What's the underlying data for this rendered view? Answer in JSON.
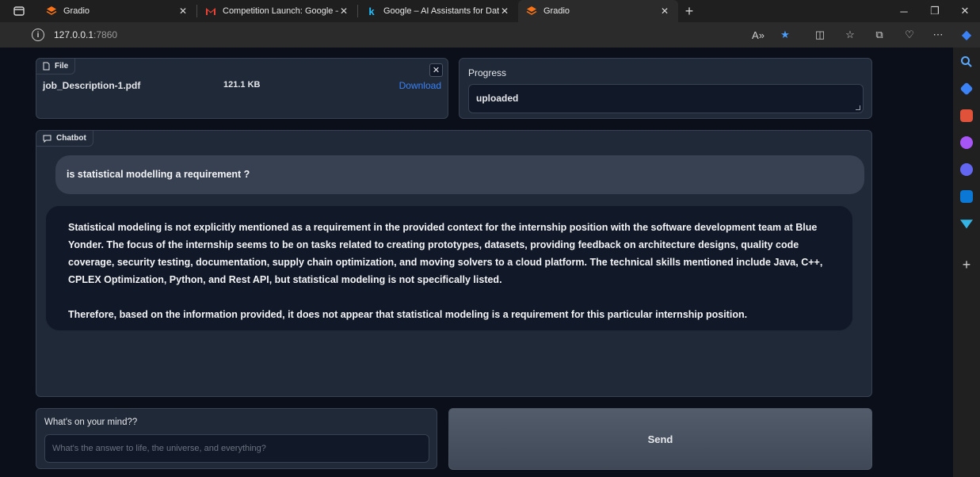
{
  "browser": {
    "tabs": [
      {
        "title": "Gradio",
        "active": false
      },
      {
        "title": "Competition Launch: Google – AI",
        "active": false
      },
      {
        "title": "Google – AI Assistants for Data T",
        "active": false
      },
      {
        "title": "Gradio",
        "active": true
      }
    ],
    "address": {
      "host": "127.0.0.1",
      "port": ":7860"
    }
  },
  "file_block": {
    "label": "File",
    "file_name": "job_Description-1.pdf",
    "file_size": "121.1 KB",
    "download_label": "Download"
  },
  "progress": {
    "label": "Progress",
    "value": "uploaded"
  },
  "chatbot": {
    "label": "Chatbot",
    "user_message": "is statistical modelling a requirement ?",
    "bot_paragraphs": [
      "Statistical modeling is not explicitly mentioned as a requirement in the provided context for the internship position with the software development team at Blue Yonder. The focus of the internship seems to be on tasks related to creating prototypes, datasets, providing feedback on architecture designs, quality code coverage, security testing, documentation, supply chain optimization, and moving solvers to a cloud platform. The technical skills mentioned include Java, C++, CPLEX Optimization, Python, and Rest API, but statistical modeling is not specifically listed.",
      "Therefore, based on the information provided, it does not appear that statistical modeling is a requirement for this particular internship position."
    ]
  },
  "prompt": {
    "label": "What's on your mind??",
    "placeholder": "What's the answer to life, the universe, and everything?"
  },
  "send": {
    "label": "Send"
  },
  "colors": {
    "accent_link": "#3b82f6",
    "panel": "#1f2937",
    "background": "#0b0f19"
  }
}
